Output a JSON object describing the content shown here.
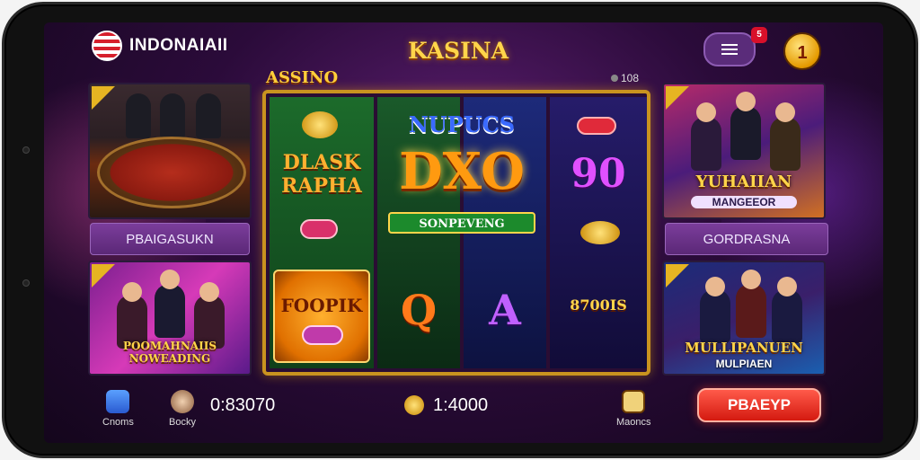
{
  "header": {
    "brand_text": "INDONAIAII",
    "logo_text": "KASINA",
    "notification_count": "5",
    "level_badge": "1",
    "flag_icon": "indonesia-flag-icon",
    "menu_icon": "menu-icon"
  },
  "slot": {
    "tab_label": "ASSINO",
    "count_label": "108",
    "reel1_top": "DLASK RAPHA",
    "center_title": "NUPUCS",
    "center_big": "DXO",
    "center_banner": "SONPEVENG",
    "reel4_top": "90",
    "feature_label": "FOOPIK",
    "symbol_q": "Q",
    "symbol_a": "A",
    "reel4_bottom": "8700IS"
  },
  "tiles": {
    "top_left_button": "PBAIGASUKN",
    "bottom_left_title": "POOMAHNAIIS NOWEADING",
    "top_right_title": "YUHAIIAN",
    "top_right_sub": "MANGEEOR",
    "top_right_button": "GORDRASNA",
    "bottom_right_title": "MULLIPANUEN",
    "bottom_right_sub": "MULPIAEN"
  },
  "bottom_bar": {
    "item1_label": "Cnoms",
    "item2_label": "Bocky",
    "balance1": "0:83070",
    "balance2": "1:4000",
    "item3_label": "Maoncs",
    "play_button": "PBAEYP"
  },
  "colors": {
    "accent_gold": "#ffd54a",
    "play_red": "#d41a10",
    "purple_panel": "#5b2877"
  }
}
